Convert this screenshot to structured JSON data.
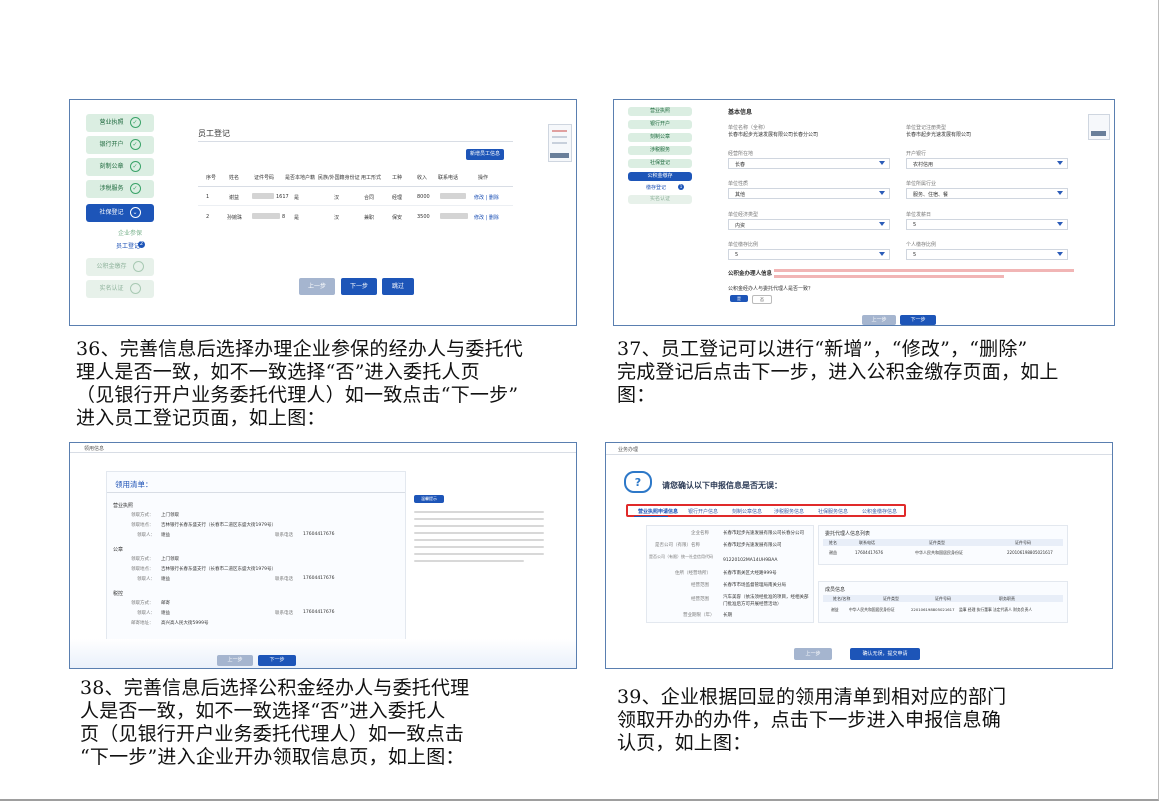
{
  "captions": {
    "c36": "36、完善信息后选择办理企业参保的经办人与委托代\n理人是否一致，如不一致选择“否”进入委托人页\n（见银行开户业务委托代理人）如一致点击“下一步”\n进入员工登记页面，如上图：",
    "c37": "37、员工登记可以进行“新增”，“修改”，“删除”\n完成登记后点击下一步，进入公积金缴存页面，如上\n图：",
    "c38": "38、完善信息后选择公积金经办人与委托代理\n人是否一致，如不一致选择“否”进入委托人\n页（见银行开户业务委托代理人）如一致点击\n“下一步”进入企业开办领取信息页，如上图：",
    "c39": "39、企业根据回显的领用清单到相对应的部门\n领取开办的办件，点击下一步进入申报信息确\n认页，如上图："
  },
  "shot1": {
    "nav": [
      "营业执照",
      "银行开户",
      "刻制公章",
      "涉税服务",
      "社保登记",
      "公积金缴存",
      "实名认证"
    ],
    "sub_items": [
      "企业参保",
      "员工登记"
    ],
    "sub_badge": "2",
    "panel_title": "员工登记",
    "add_button": "新增员工信息",
    "columns": [
      "序号",
      "姓名",
      "证件号码",
      "是否本地户籍",
      "民族/外国籍身份证",
      "用工形式",
      "工种",
      "收入",
      "联系电话",
      "操作"
    ],
    "rows": [
      {
        "no": "1",
        "name": "谢益",
        "id_suffix": "1617",
        "local": "是",
        "ethnic": "汉",
        "form": "合同",
        "job": "经理",
        "income": "8000",
        "actions": "修改 | 删除"
      },
      {
        "no": "2",
        "name": "孙婉珠",
        "id_suffix": "8",
        "local": "是",
        "ethnic": "汉",
        "form": "兼职",
        "job": "保安",
        "income": "3500",
        "actions": "修改 | 删除"
      }
    ],
    "buttons": {
      "prev": "上一步",
      "next": "下一步",
      "skip": "跳过"
    }
  },
  "shot2": {
    "nav": [
      "营业执照",
      "银行开户",
      "刻制公章",
      "涉税服务",
      "社保登记",
      "公积金缴存",
      "实名认证"
    ],
    "sub_item": "缴存登记",
    "sub_badge": "1",
    "section_title": "基本信息",
    "fields": [
      {
        "label": "单位名称（全称）",
        "value": "长春市起步光速发展有限公司长春分公司"
      },
      {
        "label": "单位登记注册类型",
        "value": "长春市起步光速发展有限公司"
      },
      {
        "label": "经营所在地",
        "value": "长春"
      },
      {
        "label": "开户银行",
        "value": "农村信用"
      },
      {
        "label": "单位性质",
        "value": "其他"
      },
      {
        "label": "单位所属行业",
        "value": "服务、住宿、餐"
      },
      {
        "label": "单位经济类型",
        "value": "内资"
      },
      {
        "label": "单位发薪日",
        "value": "5"
      },
      {
        "label": "单位缴存比例",
        "value": "5"
      },
      {
        "label": "个人缴存比例",
        "value": "5"
      }
    ],
    "agent_title": "公积金办理人信息",
    "question": "公积金经办人与委托代理人是否一致？",
    "yes": "是",
    "no": "否",
    "buttons": {
      "prev": "上一步",
      "next": "下一步"
    }
  },
  "shot3": {
    "header": "领用信息",
    "list_title": "领用清单：",
    "groups": [
      {
        "name": "营业执照",
        "method": "上门领取",
        "addr": "吉林银行长春东盛支行（长春市二道区东盛大街1979号）",
        "person": "谢益",
        "phone": "17604417676"
      },
      {
        "name": "公章",
        "method": "上门领取",
        "addr": "吉林银行长春东盛支行（长春市二道区东盛大街1979号）",
        "person": "谢益",
        "phone": "17604417676"
      },
      {
        "name": "税控",
        "method": "邮寄",
        "addr": "",
        "person": "谢益",
        "phone": "17604417676"
      }
    ],
    "labels": {
      "method": "领取方式：",
      "addr": "领取地点：",
      "person": "领取人：",
      "phone": "联系电话",
      "mail_addr": "邮寄地址："
    },
    "mail_addr_value": "高兴高人民大街5999号",
    "notice_title": "温馨提示",
    "buttons": {
      "prev": "上一步",
      "next": "下一步"
    }
  },
  "shot4": {
    "header": "业务办理",
    "title": "请您确认以下申报信息是否无误：",
    "tabs": [
      "营业执照申请信息",
      "银行开户信息",
      "刻制公章信息",
      "涉税服务信息",
      "社保服务信息",
      "公积金缴存信息"
    ],
    "left_labels": [
      "企业名称",
      "是否公司（有限）名称",
      "是否公司（有限）统一社会信用代码",
      "住所（经营场所）",
      "经营范围",
      "经营范围",
      "营业期限（年）"
    ],
    "left_values": [
      "长春市起步光速发展有限公司长春分公司",
      "长春市起步光速发展有限公司",
      "91220102MA14UH9BAA",
      "长春市南关区大经路999号",
      "长春市市场监督管理局南关分局",
      "汽车美容（依法须经批准的项目，经相关部门批准后方可开展经营活动）",
      "长期"
    ],
    "agent_title": "委托代理人信息列表",
    "agent_cols": [
      "姓名",
      "联系电话",
      "证件类型",
      "证件号码"
    ],
    "agent_row": [
      "谢益",
      "17604417676",
      "中华人民共和国居民身份证",
      "220106198805021617"
    ],
    "member_title": "成员信息",
    "member_cols": [
      "姓名/名称",
      "证件类型",
      "证件号码",
      "职务职责"
    ],
    "member_row": [
      "谢益",
      "中华人民共和国居民身份证",
      "220106198805021617",
      "监事 经理 执行董事 法定代表人 财务负责人"
    ],
    "buttons": {
      "prev": "上一步",
      "confirm": "确认无误，提交申请"
    }
  }
}
